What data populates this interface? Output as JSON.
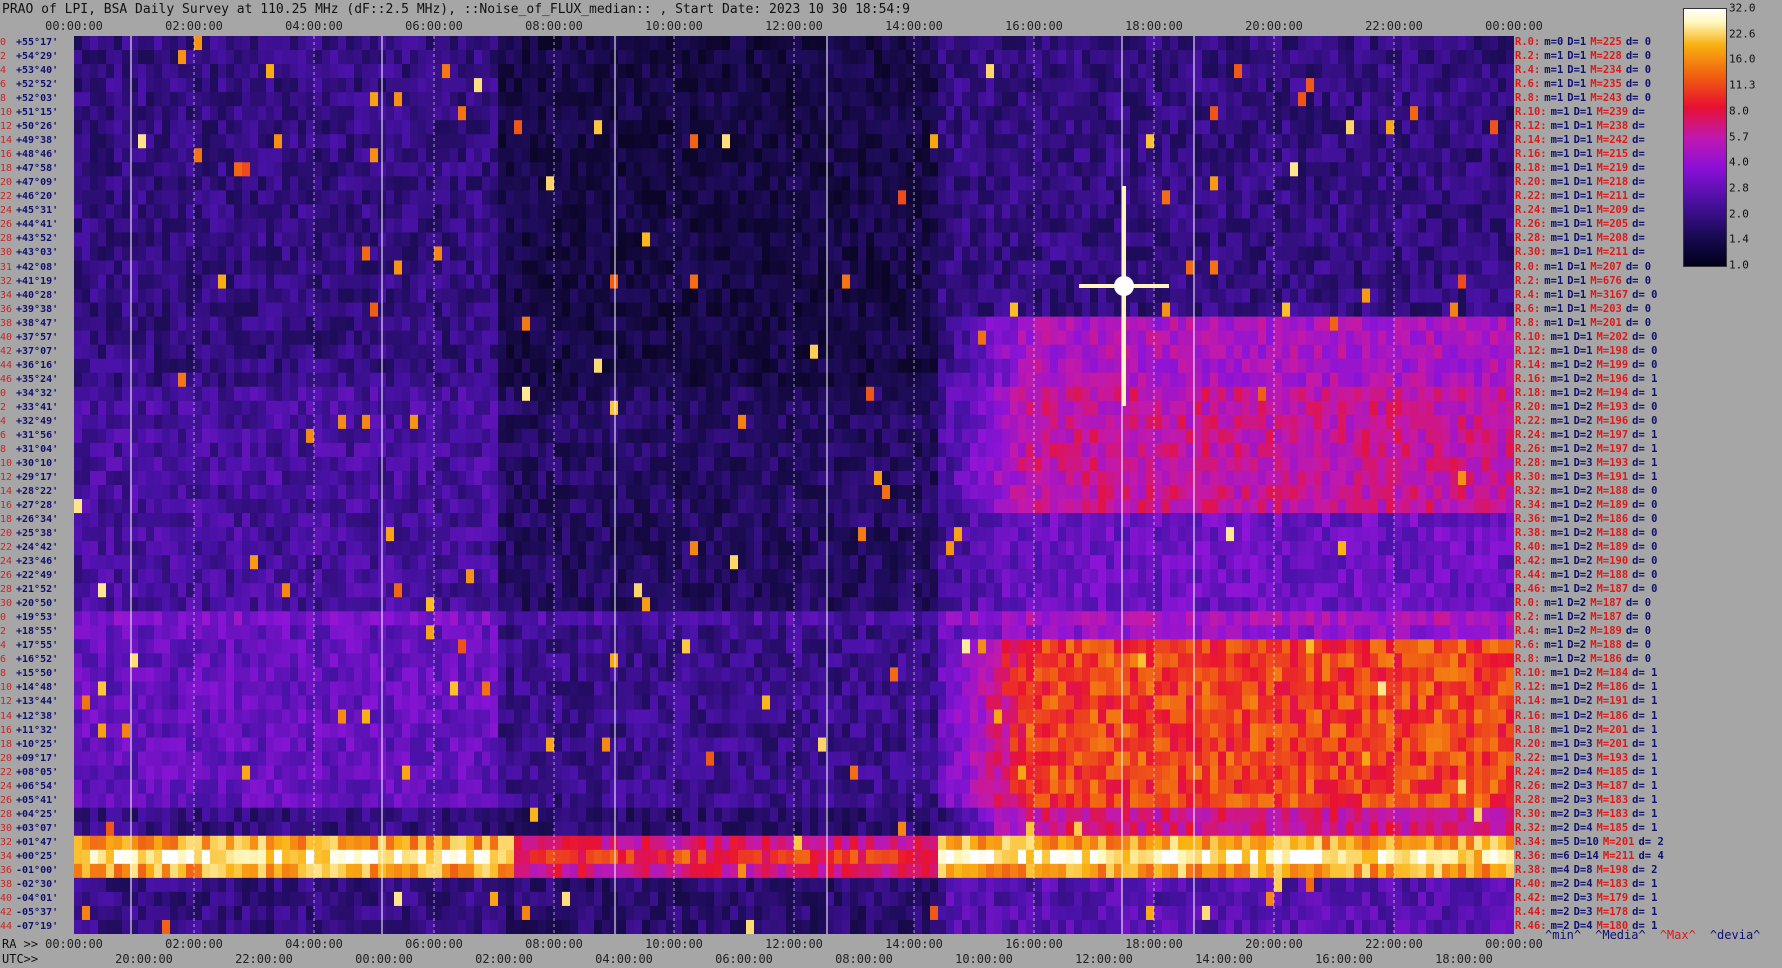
{
  "title": "PRAO of LPI, BSA Daily Survey at 110.25 MHz (dF::2.5 MHz), ::Noise_of_FLUX_median:: , Start Date: 2023 10 30 18:54:9",
  "colors": {
    "background": "#a6a6a6",
    "stat_red": "#e01818",
    "stat_blue": "#10106e"
  },
  "chart_data": {
    "type": "heatmap",
    "top_axis_ticks": [
      "00:00:00",
      "02:00:00",
      "04:00:00",
      "06:00:00",
      "08:00:00",
      "10:00:00",
      "12:00:00",
      "14:00:00",
      "16:00:00",
      "18:00:00",
      "20:00:00",
      "22:00:00",
      "00:00:00"
    ],
    "ra_label": "RA >>",
    "ra_ticks": [
      "00:00:00",
      "02:00:00",
      "04:00:00",
      "06:00:00",
      "08:00:00",
      "10:00:00",
      "12:00:00",
      "14:00:00",
      "16:00:00",
      "18:00:00",
      "20:00:00",
      "22:00:00",
      "00:00:00"
    ],
    "utc_label": "UTC>>",
    "utc_ticks": [
      "20:00:00",
      "22:00:00",
      "00:00:00",
      "02:00:00",
      "04:00:00",
      "06:00:00",
      "08:00:00",
      "10:00:00",
      "12:00:00",
      "14:00:00",
      "16:00:00",
      "18:00:00"
    ],
    "colorbar_ticks": [
      "32.0",
      "22.6",
      "16.0",
      "11.3",
      "8.0",
      "5.7",
      "4.0",
      "2.8",
      "2.0",
      "1.4",
      "1.0"
    ],
    "colorbar_scale": "log2",
    "dec_rows": [
      {
        "idx": "0",
        "dec": "+55°17'"
      },
      {
        "idx": "2",
        "dec": "+54°29'"
      },
      {
        "idx": "4",
        "dec": "+53°40'"
      },
      {
        "idx": "6",
        "dec": "+52°52'"
      },
      {
        "idx": "8",
        "dec": "+52°03'"
      },
      {
        "idx": "10",
        "dec": "+51°15'"
      },
      {
        "idx": "12",
        "dec": "+50°26'"
      },
      {
        "idx": "14",
        "dec": "+49°38'"
      },
      {
        "idx": "16",
        "dec": "+48°46'"
      },
      {
        "idx": "18",
        "dec": "+47°58'"
      },
      {
        "idx": "20",
        "dec": "+47°09'"
      },
      {
        "idx": "22",
        "dec": "+46°20'"
      },
      {
        "idx": "24",
        "dec": "+45°31'"
      },
      {
        "idx": "26",
        "dec": "+44°41'"
      },
      {
        "idx": "28",
        "dec": "+43°52'"
      },
      {
        "idx": "30",
        "dec": "+43°03'"
      },
      {
        "idx": "31",
        "dec": "+42°08'"
      },
      {
        "idx": "32",
        "dec": "+41°19'"
      },
      {
        "idx": "34",
        "dec": "+40°28'"
      },
      {
        "idx": "36",
        "dec": "+39°38'"
      },
      {
        "idx": "38",
        "dec": "+38°47'"
      },
      {
        "idx": "40",
        "dec": "+37°57'"
      },
      {
        "idx": "42",
        "dec": "+37°07'"
      },
      {
        "idx": "44",
        "dec": "+36°16'"
      },
      {
        "idx": "46",
        "dec": "+35°24'"
      },
      {
        "idx": "0",
        "dec": "+34°32'"
      },
      {
        "idx": "2",
        "dec": "+33°41'"
      },
      {
        "idx": "4",
        "dec": "+32°49'"
      },
      {
        "idx": "6",
        "dec": "+31°56'"
      },
      {
        "idx": "8",
        "dec": "+31°04'"
      },
      {
        "idx": "10",
        "dec": "+30°10'"
      },
      {
        "idx": "12",
        "dec": "+29°17'"
      },
      {
        "idx": "14",
        "dec": "+28°22'"
      },
      {
        "idx": "16",
        "dec": "+27°28'"
      },
      {
        "idx": "18",
        "dec": "+26°34'"
      },
      {
        "idx": "20",
        "dec": "+25°38'"
      },
      {
        "idx": "22",
        "dec": "+24°42'"
      },
      {
        "idx": "24",
        "dec": "+23°46'"
      },
      {
        "idx": "26",
        "dec": "+22°49'"
      },
      {
        "idx": "28",
        "dec": "+21°52'"
      },
      {
        "idx": "30",
        "dec": "+20°50'"
      },
      {
        "idx": "0",
        "dec": "+19°53'"
      },
      {
        "idx": "2",
        "dec": "+18°55'"
      },
      {
        "idx": "4",
        "dec": "+17°55'"
      },
      {
        "idx": "6",
        "dec": "+16°52'"
      },
      {
        "idx": "8",
        "dec": "+15°50'"
      },
      {
        "idx": "10",
        "dec": "+14°48'"
      },
      {
        "idx": "12",
        "dec": "+13°44'"
      },
      {
        "idx": "14",
        "dec": "+12°38'"
      },
      {
        "idx": "16",
        "dec": "+11°32'"
      },
      {
        "idx": "18",
        "dec": "+10°25'"
      },
      {
        "idx": "20",
        "dec": "+09°17'"
      },
      {
        "idx": "22",
        "dec": "+08°05'"
      },
      {
        "idx": "24",
        "dec": "+06°54'"
      },
      {
        "idx": "26",
        "dec": "+05°41'"
      },
      {
        "idx": "28",
        "dec": "+04°25'"
      },
      {
        "idx": "30",
        "dec": "+03°07'"
      },
      {
        "idx": "32",
        "dec": "+01°47'"
      },
      {
        "idx": "34",
        "dec": "+00°25'"
      },
      {
        "idx": "36",
        "dec": "-01°00'"
      },
      {
        "idx": "38",
        "dec": "-02°30'"
      },
      {
        "idx": "40",
        "dec": "-04°01'"
      },
      {
        "idx": "42",
        "dec": "-05°37'"
      },
      {
        "idx": "44",
        "dec": "-07°19'"
      }
    ],
    "row_stats": [
      {
        "label": "R.0:",
        "min": "m=0",
        "d": "D=1",
        "max": "M=225",
        "dev": "d= 0"
      },
      {
        "label": "R.2:",
        "min": "m=1",
        "d": "D=1",
        "max": "M=228",
        "dev": "d= 0"
      },
      {
        "label": "R.4:",
        "min": "m=1",
        "d": "D=1",
        "max": "M=234",
        "dev": "d= 0"
      },
      {
        "label": "R.6:",
        "min": "m=1",
        "d": "D=1",
        "max": "M=235",
        "dev": "d= 0"
      },
      {
        "label": "R.8:",
        "min": "m=1",
        "d": "D=1",
        "max": "M=243",
        "dev": "d= 0"
      },
      {
        "label": "R.10:",
        "min": "m=1",
        "d": "D=1",
        "max": "M=239",
        "dev": "d="
      },
      {
        "label": "R.12:",
        "min": "m=1",
        "d": "D=1",
        "max": "M=238",
        "dev": "d="
      },
      {
        "label": "R.14:",
        "min": "m=1",
        "d": "D=1",
        "max": "M=242",
        "dev": "d="
      },
      {
        "label": "R.16:",
        "min": "m=1",
        "d": "D=1",
        "max": "M=215",
        "dev": "d="
      },
      {
        "label": "R.18:",
        "min": "m=1",
        "d": "D=1",
        "max": "M=219",
        "dev": "d="
      },
      {
        "label": "R.20:",
        "min": "m=1",
        "d": "D=1",
        "max": "M=218",
        "dev": "d="
      },
      {
        "label": "R.22:",
        "min": "m=1",
        "d": "D=1",
        "max": "M=211",
        "dev": "d="
      },
      {
        "label": "R.24:",
        "min": "m=1",
        "d": "D=1",
        "max": "M=209",
        "dev": "d="
      },
      {
        "label": "R.26:",
        "min": "m=1",
        "d": "D=1",
        "max": "M=205",
        "dev": "d="
      },
      {
        "label": "R.28:",
        "min": "m=1",
        "d": "D=1",
        "max": "M=208",
        "dev": "d="
      },
      {
        "label": "R.30:",
        "min": "m=1",
        "d": "D=1",
        "max": "M=211",
        "dev": "d="
      },
      {
        "label": "R.0:",
        "min": "m=1",
        "d": "D=1",
        "max": "M=207",
        "dev": "d= 0"
      },
      {
        "label": "R.2:",
        "min": "m=1",
        "d": "D=1",
        "max": "M=676",
        "dev": "d= 0"
      },
      {
        "label": "R.4:",
        "min": "m=1",
        "d": "D=1",
        "max": "M=3167",
        "dev": "d= 0"
      },
      {
        "label": "R.6:",
        "min": "m=1",
        "d": "D=1",
        "max": "M=203",
        "dev": "d= 0"
      },
      {
        "label": "R.8:",
        "min": "m=1",
        "d": "D=1",
        "max": "M=201",
        "dev": "d= 0"
      },
      {
        "label": "R.10:",
        "min": "m=1",
        "d": "D=1",
        "max": "M=202",
        "dev": "d= 0"
      },
      {
        "label": "R.12:",
        "min": "m=1",
        "d": "D=1",
        "max": "M=198",
        "dev": "d= 0"
      },
      {
        "label": "R.14:",
        "min": "m=1",
        "d": "D=2",
        "max": "M=199",
        "dev": "d= 0"
      },
      {
        "label": "R.16:",
        "min": "m=1",
        "d": "D=2",
        "max": "M=196",
        "dev": "d= 1"
      },
      {
        "label": "R.18:",
        "min": "m=1",
        "d": "D=2",
        "max": "M=194",
        "dev": "d= 1"
      },
      {
        "label": "R.20:",
        "min": "m=1",
        "d": "D=2",
        "max": "M=193",
        "dev": "d= 0"
      },
      {
        "label": "R.22:",
        "min": "m=1",
        "d": "D=2",
        "max": "M=196",
        "dev": "d= 0"
      },
      {
        "label": "R.24:",
        "min": "m=1",
        "d": "D=2",
        "max": "M=197",
        "dev": "d= 1"
      },
      {
        "label": "R.26:",
        "min": "m=1",
        "d": "D=2",
        "max": "M=197",
        "dev": "d= 1"
      },
      {
        "label": "R.28:",
        "min": "m=1",
        "d": "D=3",
        "max": "M=193",
        "dev": "d= 1"
      },
      {
        "label": "R.30:",
        "min": "m=1",
        "d": "D=3",
        "max": "M=191",
        "dev": "d= 1"
      },
      {
        "label": "R.32:",
        "min": "m=1",
        "d": "D=2",
        "max": "M=188",
        "dev": "d= 0"
      },
      {
        "label": "R.34:",
        "min": "m=1",
        "d": "D=2",
        "max": "M=189",
        "dev": "d= 0"
      },
      {
        "label": "R.36:",
        "min": "m=1",
        "d": "D=2",
        "max": "M=186",
        "dev": "d= 0"
      },
      {
        "label": "R.38:",
        "min": "m=1",
        "d": "D=2",
        "max": "M=188",
        "dev": "d= 0"
      },
      {
        "label": "R.40:",
        "min": "m=1",
        "d": "D=2",
        "max": "M=189",
        "dev": "d= 0"
      },
      {
        "label": "R.42:",
        "min": "m=1",
        "d": "D=2",
        "max": "M=190",
        "dev": "d= 0"
      },
      {
        "label": "R.44:",
        "min": "m=1",
        "d": "D=2",
        "max": "M=188",
        "dev": "d= 0"
      },
      {
        "label": "R.46:",
        "min": "m=1",
        "d": "D=2",
        "max": "M=187",
        "dev": "d= 0"
      },
      {
        "label": "R.0:",
        "min": "m=1",
        "d": "D=2",
        "max": "M=187",
        "dev": "d= 0"
      },
      {
        "label": "R.2:",
        "min": "m=1",
        "d": "D=2",
        "max": "M=187",
        "dev": "d= 0"
      },
      {
        "label": "R.4:",
        "min": "m=1",
        "d": "D=2",
        "max": "M=189",
        "dev": "d= 0"
      },
      {
        "label": "R.6:",
        "min": "m=1",
        "d": "D=2",
        "max": "M=188",
        "dev": "d= 0"
      },
      {
        "label": "R.8:",
        "min": "m=1",
        "d": "D=2",
        "max": "M=186",
        "dev": "d= 0"
      },
      {
        "label": "R.10:",
        "min": "m=1",
        "d": "D=2",
        "max": "M=184",
        "dev": "d= 1"
      },
      {
        "label": "R.12:",
        "min": "m=1",
        "d": "D=2",
        "max": "M=186",
        "dev": "d= 1"
      },
      {
        "label": "R.14:",
        "min": "m=1",
        "d": "D=2",
        "max": "M=191",
        "dev": "d= 1"
      },
      {
        "label": "R.16:",
        "min": "m=1",
        "d": "D=2",
        "max": "M=186",
        "dev": "d= 1"
      },
      {
        "label": "R.18:",
        "min": "m=1",
        "d": "D=2",
        "max": "M=201",
        "dev": "d= 1"
      },
      {
        "label": "R.20:",
        "min": "m=1",
        "d": "D=3",
        "max": "M=201",
        "dev": "d= 1"
      },
      {
        "label": "R.22:",
        "min": "m=1",
        "d": "D=3",
        "max": "M=193",
        "dev": "d= 1"
      },
      {
        "label": "R.24:",
        "min": "m=2",
        "d": "D=4",
        "max": "M=185",
        "dev": "d= 1"
      },
      {
        "label": "R.26:",
        "min": "m=2",
        "d": "D=3",
        "max": "M=187",
        "dev": "d= 1"
      },
      {
        "label": "R.28:",
        "min": "m=2",
        "d": "D=3",
        "max": "M=183",
        "dev": "d= 1"
      },
      {
        "label": "R.30:",
        "min": "m=2",
        "d": "D=3",
        "max": "M=183",
        "dev": "d= 1"
      },
      {
        "label": "R.32:",
        "min": "m=2",
        "d": "D=4",
        "max": "M=185",
        "dev": "d= 1"
      },
      {
        "label": "R.34:",
        "min": "m=5",
        "d": "D=10",
        "max": "M=201",
        "dev": "d= 2"
      },
      {
        "label": "R.36:",
        "min": "m=6",
        "d": "D=14",
        "max": "M=211",
        "dev": "d= 4"
      },
      {
        "label": "R.38:",
        "min": "m=4",
        "d": "D=8",
        "max": "M=198",
        "dev": "d= 2"
      },
      {
        "label": "R.40:",
        "min": "m=2",
        "d": "D=4",
        "max": "M=183",
        "dev": "d= 1"
      },
      {
        "label": "R.42:",
        "min": "m=2",
        "d": "D=3",
        "max": "M=179",
        "dev": "d= 1"
      },
      {
        "label": "R.44:",
        "min": "m=2",
        "d": "D=3",
        "max": "M=178",
        "dev": "d= 1"
      },
      {
        "label": "R.46:",
        "min": "m=2",
        "d": "D=4",
        "max": "M=180",
        "dev": "d= 1"
      }
    ],
    "stats_legend": [
      "^min^",
      "^Media^",
      "^Max^",
      "^devia^"
    ]
  }
}
